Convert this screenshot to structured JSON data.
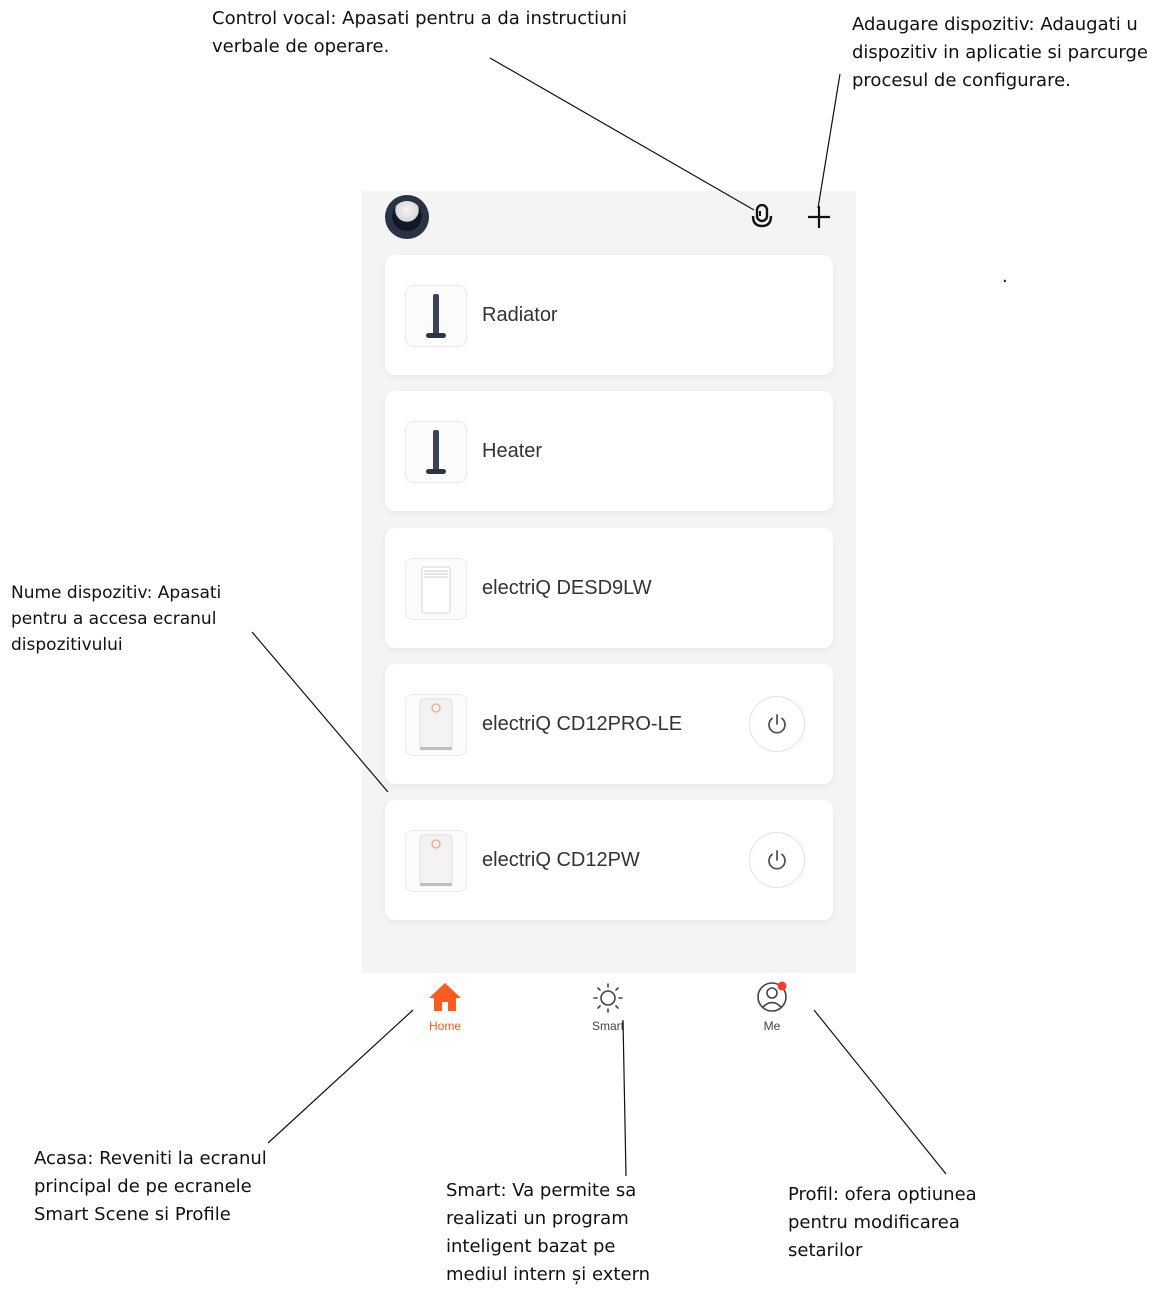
{
  "annotations": {
    "voice": [
      "Control vocal: Apasati pentru a da instructiuni",
      "verbale de operare."
    ],
    "add": [
      "Adaugare dispozitiv: Adaugati u",
      "dispozitiv in aplicatie si parcurge",
      "procesul de configurare."
    ],
    "device_name": [
      "Nume dispozitiv: Apasati",
      "pentru a accesa ecranul",
      "dispozitivului"
    ],
    "home": [
      "Acasa: Reveniti la ecranul",
      "principal de pe ecranele",
      "Smart Scene si Profile"
    ],
    "smart": [
      "Smart: Va permite sa",
      "realizati un program",
      "inteligent bazat pe",
      "mediul intern și extern"
    ],
    "profile": [
      "Profil: ofera optiunea",
      "pentru modificarea",
      "setarilor"
    ],
    "stray_dot": "."
  },
  "header": {
    "avatar_icon": "avatar-icon",
    "mic_icon": "microphone-icon",
    "add_icon": "plus-icon"
  },
  "devices": [
    {
      "name": "Radiator",
      "icon": "tower-heater-icon",
      "power": false
    },
    {
      "name": "Heater",
      "icon": "tower-heater-icon",
      "power": false
    },
    {
      "name": "electriQ DESD9LW",
      "icon": "dehumidifier-icon",
      "power": false
    },
    {
      "name": "electriQ CD12PRO-LE",
      "icon": "dehumidifier-icon",
      "power": true
    },
    {
      "name": "electriQ CD12PW",
      "icon": "dehumidifier-icon",
      "power": true
    }
  ],
  "tabs": {
    "home": "Home",
    "smart": "Smart",
    "me": "Me"
  },
  "colors": {
    "accent": "#ff5a1f",
    "notification_dot": "#ff3b30",
    "inactive_tab": "#444444",
    "app_background": "#f4f4f4"
  }
}
